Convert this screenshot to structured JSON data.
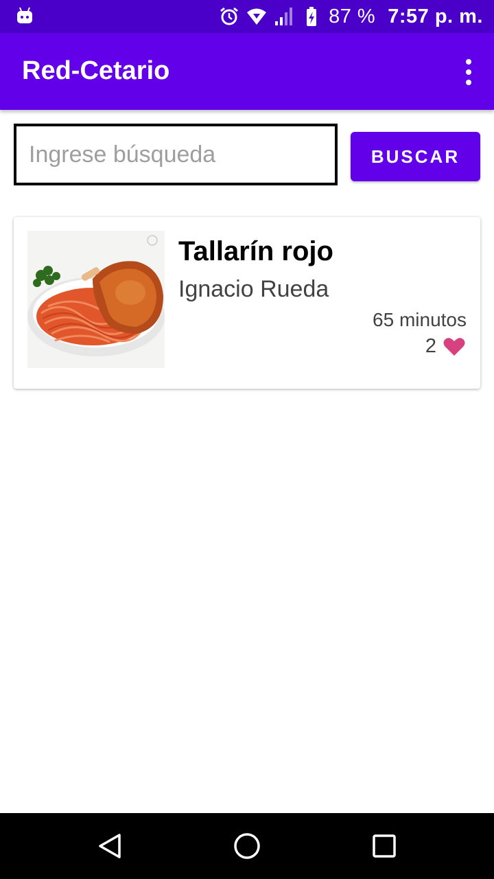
{
  "status_bar": {
    "battery": "87 %",
    "time": "7:57 p. m.",
    "icons": [
      "android-robot-icon",
      "alarm-icon",
      "wifi-icon",
      "signal-icon",
      "battery-charging-icon"
    ]
  },
  "app_bar": {
    "title": "Red-Cetario",
    "menu_icon": "overflow-menu-icon"
  },
  "search": {
    "placeholder": "Ingrese búsqueda",
    "value": "",
    "button_label": "BUSCAR"
  },
  "recipes": [
    {
      "title": "Tallarín rojo",
      "author": "Ignacio Rueda",
      "time": "65 minutos",
      "likes": "2",
      "like_icon": "heart-icon",
      "like_color": "#d6417f"
    }
  ],
  "nav_bar": {
    "buttons": [
      "back-icon",
      "home-icon",
      "recents-icon"
    ]
  },
  "colors": {
    "status_bar": "#4a00c8",
    "primary": "#6200ea",
    "heart": "#d6417f"
  }
}
